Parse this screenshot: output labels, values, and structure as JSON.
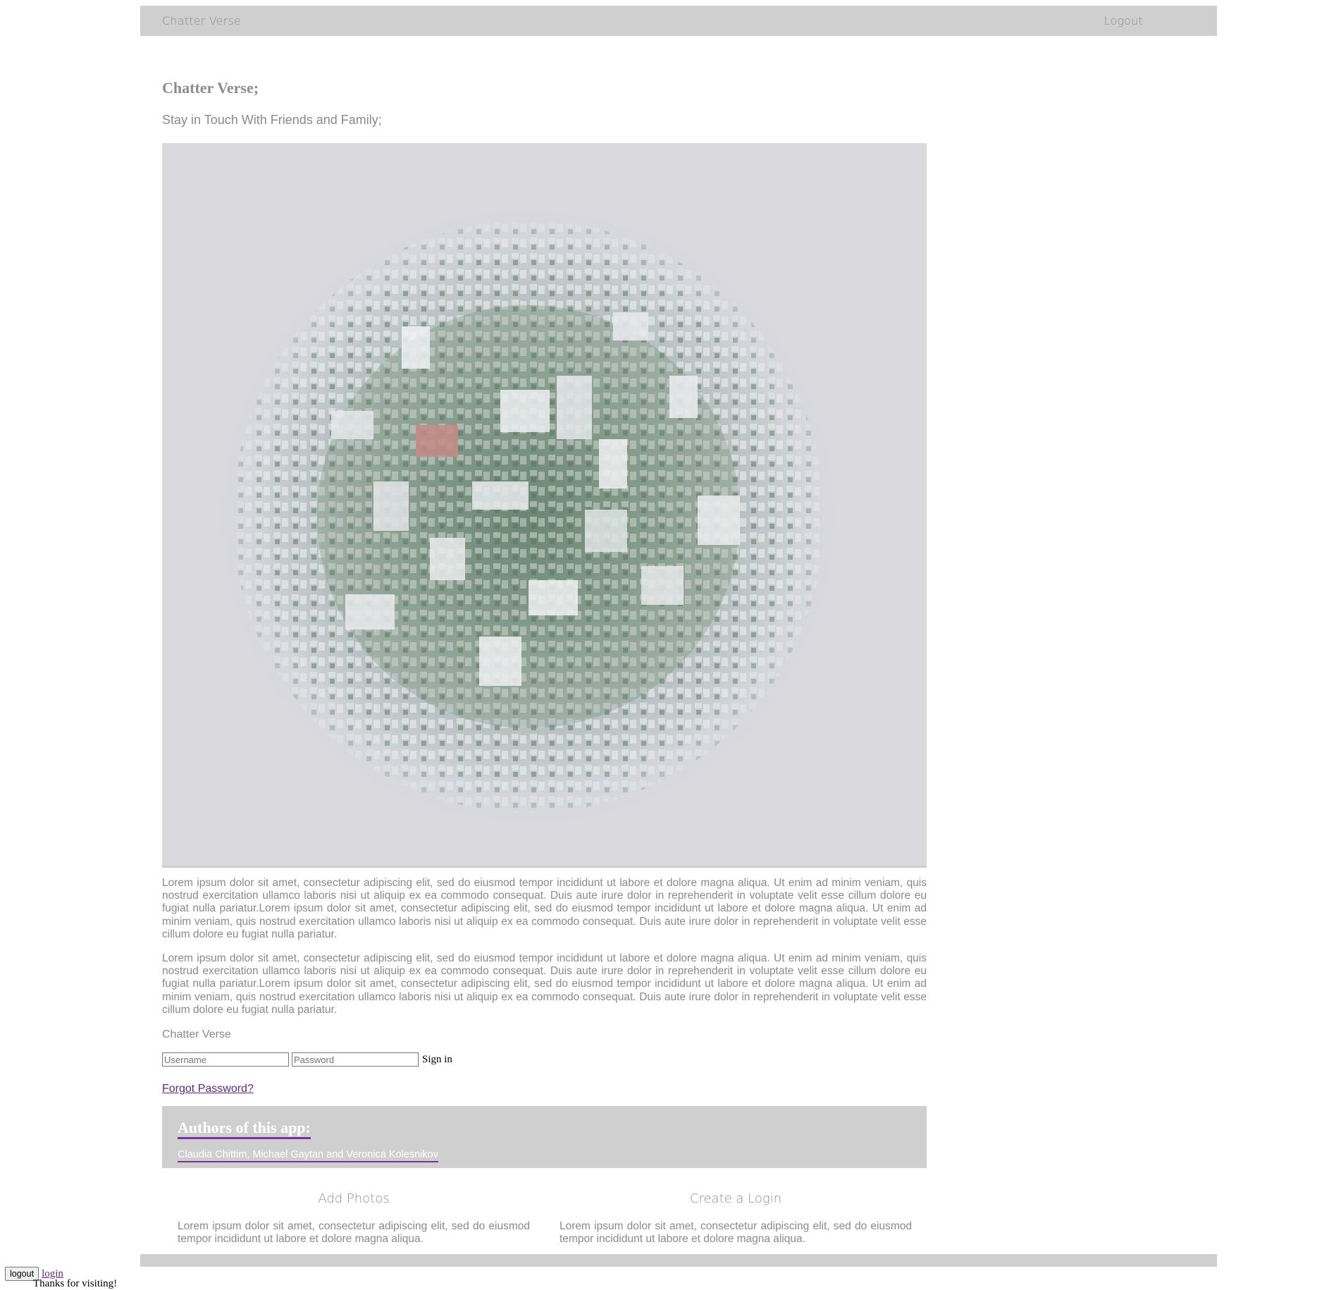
{
  "navbar": {
    "brand": "Chatter Verse",
    "logout_label": "Logout"
  },
  "main": {
    "title": "Chatter Verse;",
    "tagline": "Stay in Touch With Friends and Family;",
    "hero_image": "tiny-planet aerial city photo",
    "paragraph_1": "Lorem ipsum dolor sit amet, consectetur adipiscing elit, sed do eiusmod tempor incididunt ut labore et dolore magna aliqua. Ut enim ad minim veniam, quis nostrud exercitation ullamco laboris nisi ut aliquip ex ea commodo consequat. Duis aute irure dolor in reprehenderit in voluptate velit esse cillum dolore eu fugiat nulla pariatur.Lorem ipsum dolor sit amet, consectetur adipiscing elit, sed do eiusmod tempor incididunt ut labore et dolore magna aliqua. Ut enim ad minim veniam, quis nostrud exercitation ullamco laboris nisi ut aliquip ex ea commodo consequat. Duis aute irure dolor in reprehenderit in voluptate velit esse cillum dolore eu fugiat nulla pariatur.",
    "paragraph_2": "Lorem ipsum dolor sit amet, consectetur adipiscing elit, sed do eiusmod tempor incididunt ut labore et dolore magna aliqua. Ut enim ad minim veniam, quis nostrud exercitation ullamco laboris nisi ut aliquip ex ea commodo consequat. Duis aute irure dolor in reprehenderit in voluptate velit esse cillum dolore eu fugiat nulla pariatur.Lorem ipsum dolor sit amet, consectetur adipiscing elit, sed do eiusmod tempor incididunt ut labore et dolore magna aliqua. Ut enim ad minim veniam, quis nostrud exercitation ullamco laboris nisi ut aliquip ex ea commodo consequat. Duis aute irure dolor in reprehenderit in voluptate velit esse cillum dolore eu fugiat nulla pariatur.",
    "brand_small": "Chatter Verse"
  },
  "signin": {
    "username_placeholder": "Username",
    "password_placeholder": "Password",
    "signin_label": "Sign in",
    "forgot_label": "Forgot Password?"
  },
  "authors": {
    "heading": "Authors of this app:",
    "names": "Claudia Chittim, Michael Gaytan and Veronica Kolesnikov"
  },
  "features": [
    {
      "title": "Add Photos",
      "text": "Lorem ipsum dolor sit amet, consectetur adipiscing elit, sed do eiusmod tempor incididunt ut labore et dolore magna aliqua."
    },
    {
      "title": "Create a Login",
      "text": "Lorem ipsum dolor sit amet, consectetur adipiscing elit, sed do eiusmod tempor incididunt ut labore et dolore magna aliqua."
    }
  ],
  "bottom": {
    "logout_button": "logout",
    "login_link": "login",
    "thanks": "Thanks for visiting!"
  },
  "colors": {
    "bar_gray": "#cfcfd0",
    "text_gray": "#8a8a8a",
    "link_purple": "#5a2a78"
  }
}
